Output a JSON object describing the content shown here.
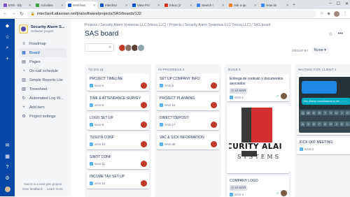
{
  "browser": {
    "tabs": [
      {
        "label": "ESS - Ely",
        "color": "#7e57c2"
      },
      {
        "label": "Activities",
        "color": "#43a047"
      },
      {
        "label": "SAS boa",
        "color": "#0052cc",
        "active": true
      },
      {
        "label": "Intechso",
        "color": "#0052cc"
      },
      {
        "label": "View Pro",
        "color": "#0052cc"
      },
      {
        "label": "Inbox (2",
        "color": "#d93025"
      },
      {
        "label": "Search r",
        "color": "#4285f4"
      },
      {
        "label": "Ask a qu",
        "color": "#f48024"
      },
      {
        "label": "How do",
        "color": "#4285f4"
      }
    ],
    "url": "intechsoll.atlassian.net/jira/software/projects/SAS/boards/132"
  },
  "sidebar": {
    "project_name": "Security Alarm S...",
    "project_type": "Software project",
    "items": [
      {
        "label": "Roadmap",
        "icon": "≡"
      },
      {
        "label": "Board",
        "icon": "▦",
        "active": true
      },
      {
        "label": "Pages",
        "icon": "▤"
      },
      {
        "label": "On-call schedule",
        "icon": "◔"
      },
      {
        "label": "Simple Reports Lite",
        "icon": "▥"
      },
      {
        "label": "Timesheet",
        "icon": "▧"
      },
      {
        "label": "Automated Log W...",
        "icon": "↻"
      },
      {
        "label": "Add item",
        "icon": "+"
      },
      {
        "label": "Project settings",
        "icon": "⚙"
      }
    ],
    "footer_line1": "You're in a next-gen project",
    "footer_give": "Give feedback",
    "footer_learn": "Learn more"
  },
  "main": {
    "breadcrumbs": "Projects  /  Security Alarm Systemas LLC (Versa LLC)  /  Projects  /  Security Alarm Systemas LLC (Versa LLC)  /  SAS board",
    "title": "SAS board",
    "group_by_label": "GROUP BY",
    "group_by_value": "None"
  },
  "board": {
    "columns": [
      {
        "name": "TO DO",
        "count": "41",
        "cards": [
          {
            "title": "PROJECT TIMELINE",
            "key": "SAS-3"
          },
          {
            "title": "TIME & ATTENDANCE SURVEY",
            "key": "SAS-8"
          },
          {
            "title": "LOGO SET UP",
            "key": "SAS-9"
          },
          {
            "title": "?USUTA CONF",
            "key": "SAS-10"
          },
          {
            "title": "SINOT CONF",
            "key": "SAS-11"
          },
          {
            "title": "INCOME TAX SET UP",
            "key": "SAS-12"
          }
        ]
      },
      {
        "name": "IN PROGRESS",
        "count": "4",
        "cards": [
          {
            "title": "SET UP COMPANY INFO",
            "key": "SAS-5"
          },
          {
            "title": "PROJECT PLANNING",
            "key": "SAS-16"
          },
          {
            "title": "DIRECT DEPOSIT",
            "key": "SAS-17"
          },
          {
            "title": "VAC & SICK INFORMATION",
            "key": "SAS-48"
          }
        ]
      },
      {
        "name": "DONE",
        "count": "6",
        "cards": [
          {
            "title": "Entrega de contrato y documentos asociados",
            "key": "SAS-1",
            "date": "10 MAR"
          },
          {
            "title": "COMPANY LOGO",
            "key": "SAS-4",
            "date": "10 MAR"
          }
        ],
        "logo_text": "CURITY ALAI",
        "logo_sub": "SYSTEMS"
      },
      {
        "name": "WAITING FOR CLIENT",
        "count": "1",
        "cards": [
          {
            "title": "KICK OFF MEETING",
            "key": "SAS-2"
          }
        ],
        "phone_msg": "Yes. Estoy coordinando a ver",
        "kb_keys": [
          "Q",
          "W",
          "E",
          "R",
          "T",
          "Y",
          "U",
          "I",
          "O",
          "P",
          "A",
          "S",
          "D",
          "F",
          "G",
          "H",
          "J",
          "K",
          "L",
          "Z"
        ]
      }
    ]
  }
}
